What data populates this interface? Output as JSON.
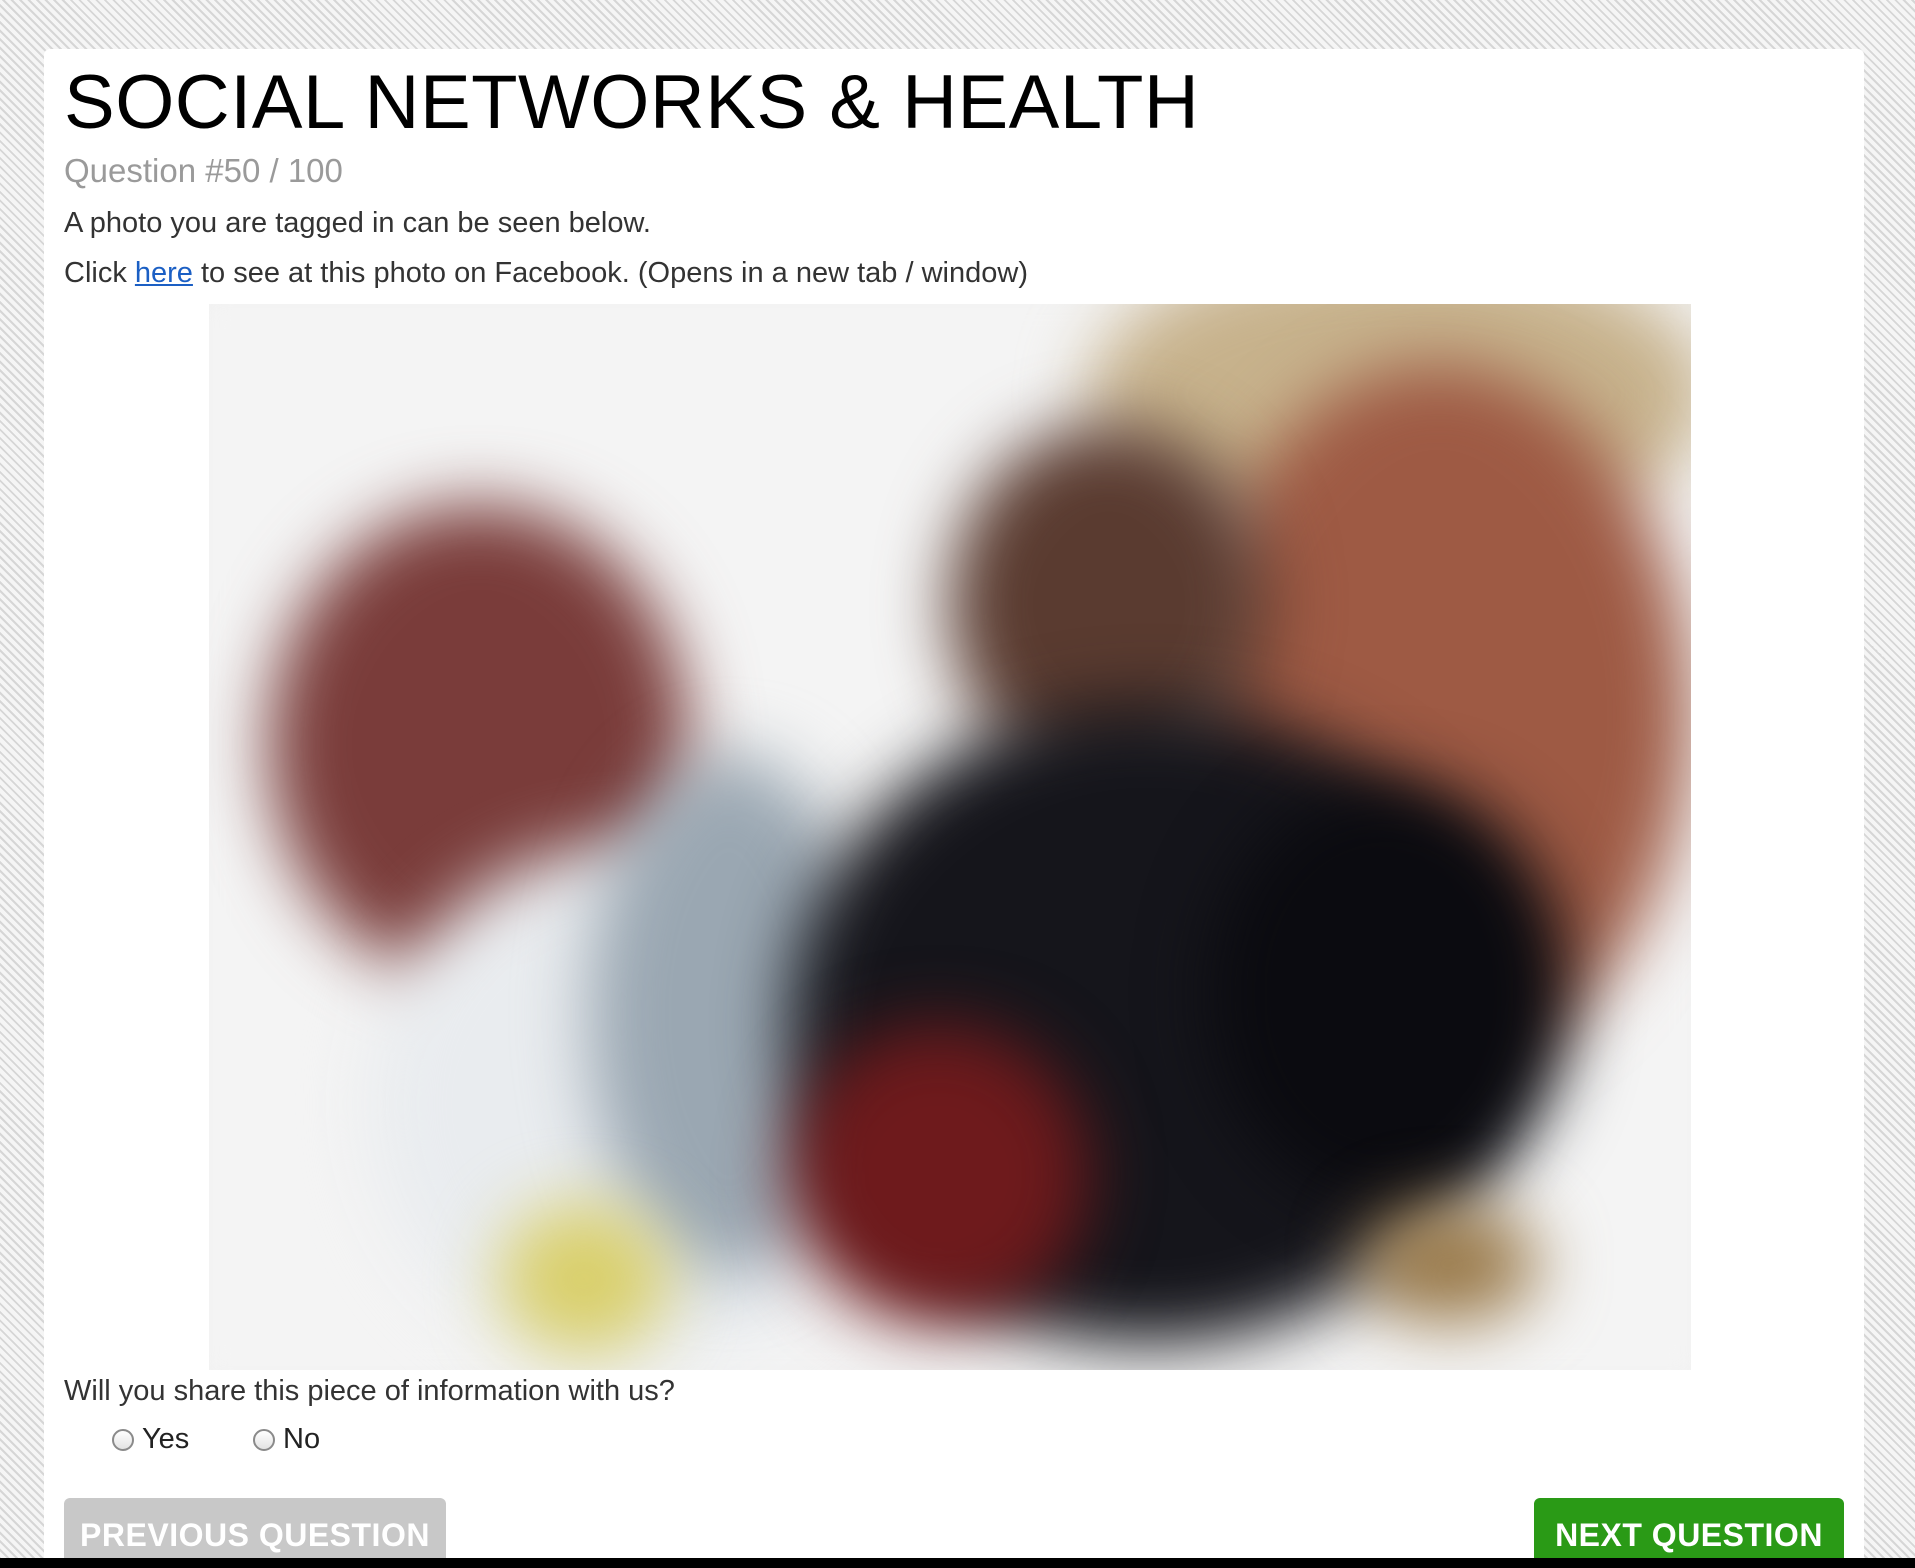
{
  "header": {
    "title": "SOCIAL NETWORKS & HEALTH",
    "question_number": "Question #50 / 100"
  },
  "body": {
    "intro": "A photo you are tagged in can be seen below.",
    "link_prefix": "Click ",
    "link_text": "here",
    "link_suffix": " to see at this photo on Facebook. (Opens in a new tab / window)"
  },
  "question": {
    "prompt": "Will you share this piece of information with us?",
    "options": [
      "Yes",
      "No"
    ],
    "selected": null
  },
  "buttons": {
    "previous_label": "PREVIOUS QUESTION",
    "next_label": "NEXT QUESTION"
  },
  "colors": {
    "next_button": "#2a9a16",
    "previous_button_disabled": "#c8c8c8",
    "link": "#1b5fc4"
  }
}
